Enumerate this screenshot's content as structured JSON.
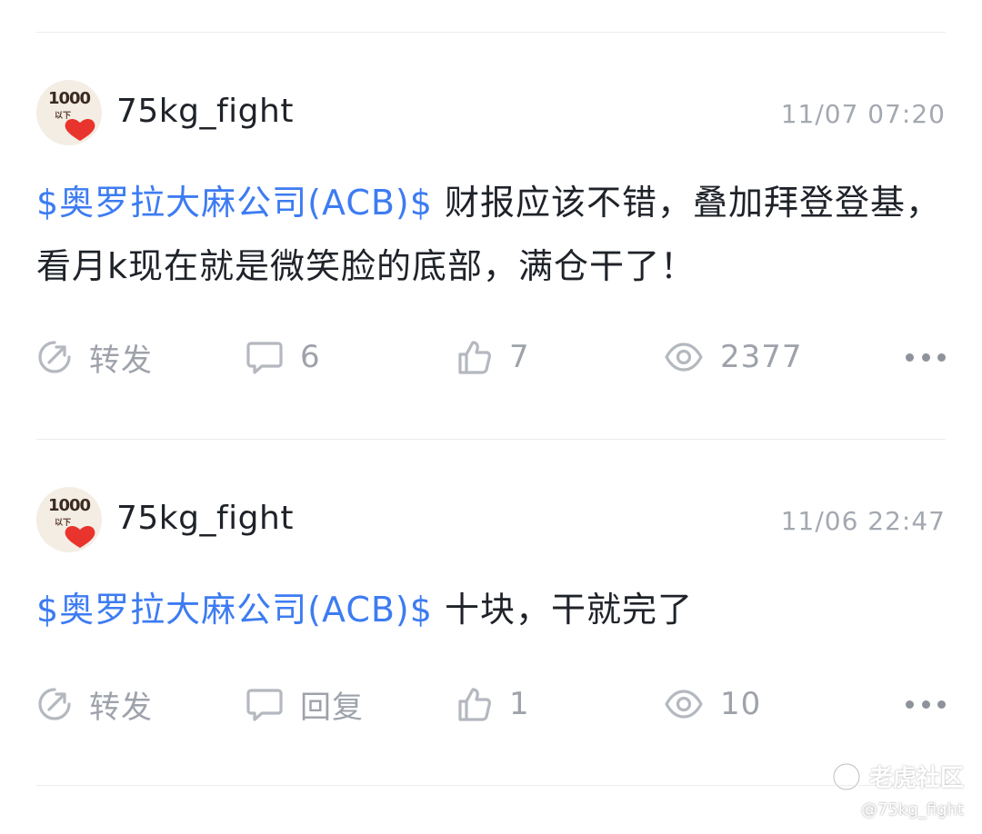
{
  "posts": [
    {
      "username": "75kg_fight",
      "timestamp": "11/07 07:20",
      "stock_link": "$奥罗拉大麻公司(ACB)$",
      "text": "财报应该不错，叠加拜登登基，看月k现在就是微笑脸的底部，满仓干了！",
      "repost_label": "转发",
      "comment_label": "6",
      "like_count": "7",
      "view_count": "2377"
    },
    {
      "username": "75kg_fight",
      "timestamp": "11/06 22:47",
      "stock_link": "$奥罗拉大麻公司(ACB)$",
      "text": "十块，干就完了",
      "repost_label": "转发",
      "comment_label": "回复",
      "like_count": "1",
      "view_count": "10"
    }
  ],
  "avatar": {
    "number": "1000",
    "sub": "以下"
  },
  "watermark": {
    "brand": "老虎社区",
    "user": "@75kg_fight"
  },
  "colors": {
    "link": "#3d7cf2",
    "icon": "#9ea2aa",
    "text": "#1f2329",
    "muted": "#a4a8b0",
    "heart": "#e8342c"
  },
  "icons": {
    "repost": "repost-icon",
    "comment": "comment-icon",
    "like": "thumbs-up-icon",
    "views": "eye-icon",
    "more": "more-dots-icon"
  }
}
